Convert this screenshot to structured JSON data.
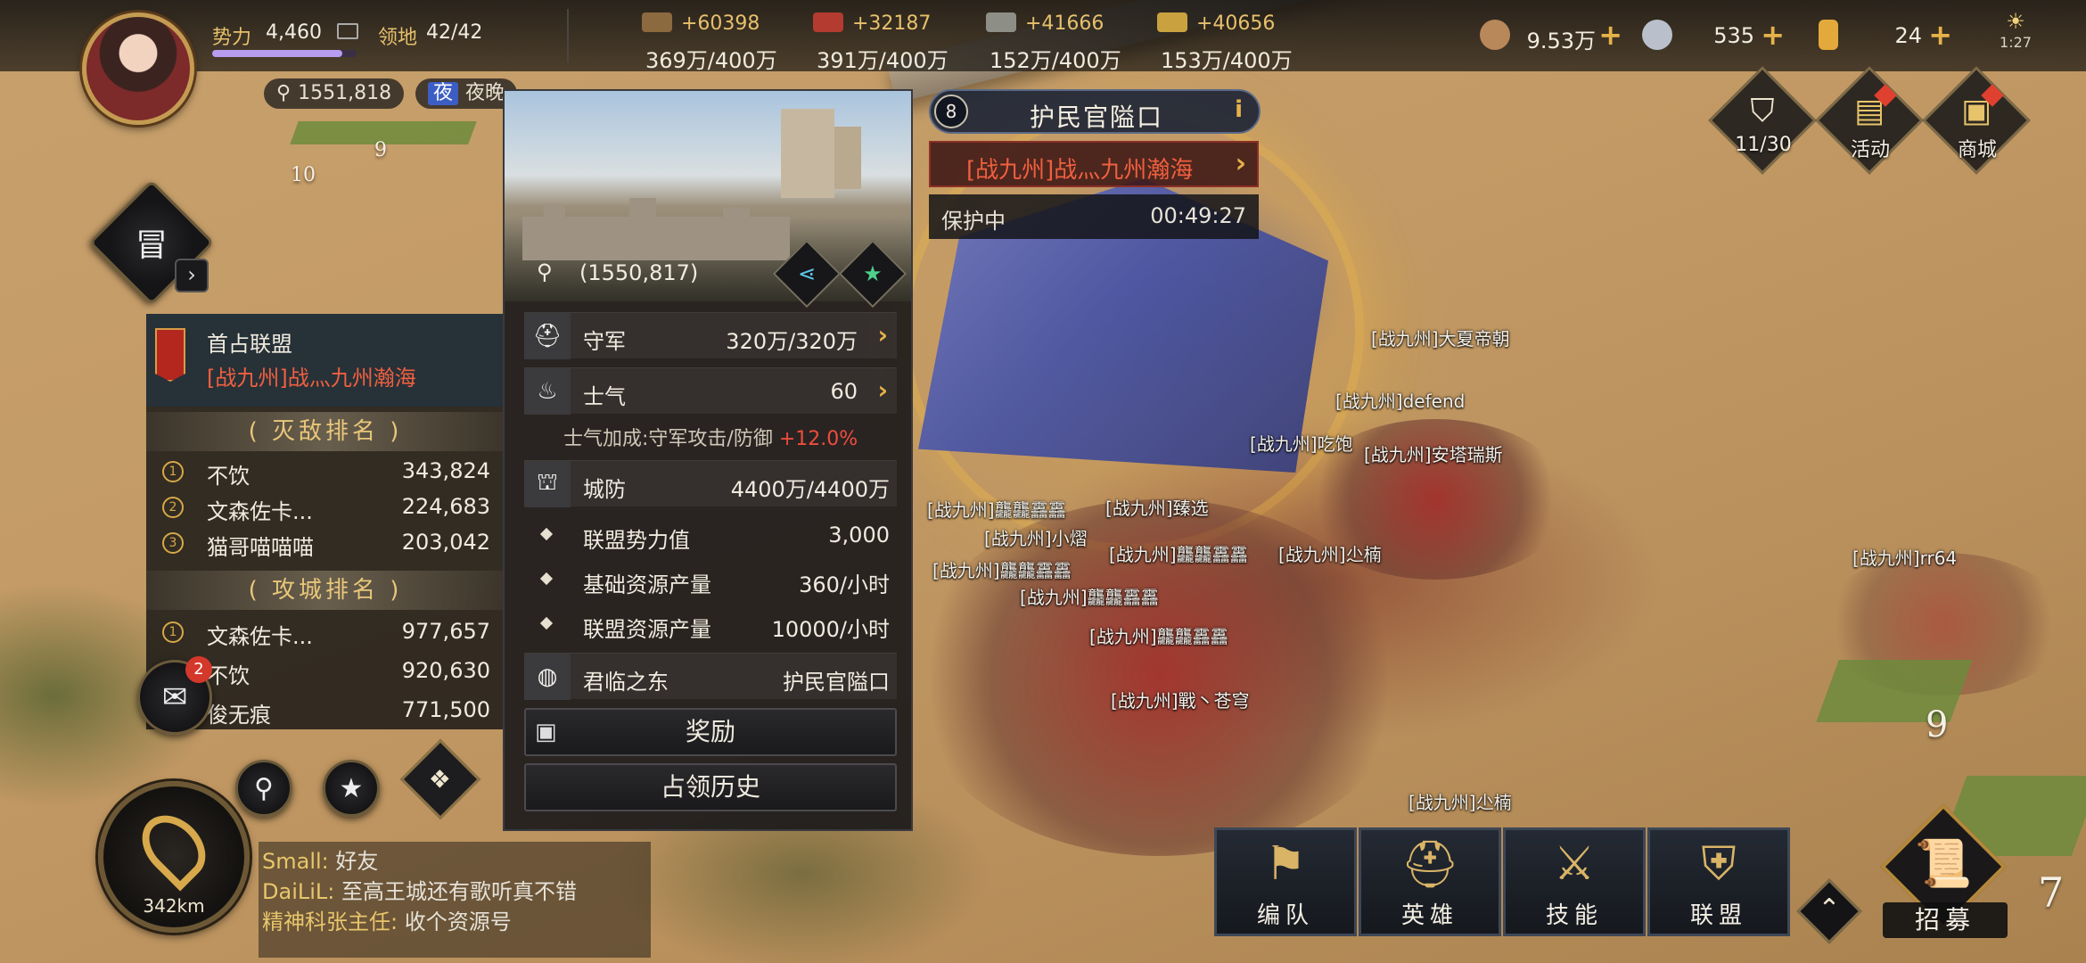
{
  "player": {
    "power_label": "势力",
    "power_value": "4,460",
    "territory_label": "领地",
    "territory_value": "42/42",
    "coord": "1551,818",
    "night_badge": "夜",
    "time_of_day": "夜晚"
  },
  "resources": [
    {
      "delta": "+60398",
      "capacity": "369万/400万",
      "color": "#8a6a3e"
    },
    {
      "delta": "+32187",
      "capacity": "391万/400万",
      "color": "#b43b2f"
    },
    {
      "delta": "+41666",
      "capacity": "152万/400万",
      "color": "#8d8f86"
    },
    {
      "delta": "+40656",
      "capacity": "153万/400万",
      "color": "#c9a23f"
    }
  ],
  "currencies": [
    {
      "value": "9.53万",
      "icon": "copper-coin-icon",
      "color": "#b8875a"
    },
    {
      "value": "535",
      "icon": "silver-coin-icon",
      "color": "#b9c0cc"
    },
    {
      "value": "24",
      "icon": "gold-bar-icon",
      "color": "#e3a93a"
    }
  ],
  "clock": "1:27",
  "city": {
    "level": "8",
    "name": "护民官隘口",
    "owner": "[战九州]战灬九州瀚海",
    "status_label": "保护中",
    "status_time": "00:49:27",
    "coord": "(1550,817)",
    "stats": {
      "garrison_label": "守军",
      "garrison_value": "320万/320万",
      "morale_label": "士气",
      "morale_value": "60",
      "morale_bonus_text": "士气加成:守军攻击/防御",
      "morale_bonus_pct": "+12.0%",
      "defense_label": "城防",
      "defense_value": "4400万/4400万",
      "alliance_power_label": "联盟势力值",
      "alliance_power_value": "3,000",
      "base_output_label": "基础资源产量",
      "base_output_value": "360/小时",
      "alliance_output_label": "联盟资源产量",
      "alliance_output_value": "10000/小时",
      "region_label": "君临之东",
      "region_value": "护民官隘口"
    },
    "reward_button": "奖励",
    "history_button": "占领历史"
  },
  "ranking": {
    "first_alliance_label": "首占联盟",
    "first_alliance_name": "[战九州]战灬九州瀚海",
    "kill_title": "灭敌排名",
    "kill": [
      {
        "no": "1",
        "name": "不饮",
        "value": "343,824"
      },
      {
        "no": "2",
        "name": "文森佐卡...",
        "value": "224,683"
      },
      {
        "no": "3",
        "name": "猫哥喵喵喵",
        "value": "203,042"
      }
    ],
    "siege_title": "攻城排名",
    "siege": [
      {
        "no": "1",
        "name": "文森佐卡...",
        "value": "977,657"
      },
      {
        "no": "2",
        "name": "不饮",
        "value": "920,630"
      },
      {
        "no": "3",
        "name": "俊无痕",
        "value": "771,500"
      }
    ]
  },
  "mail_badge": "2",
  "compass_distance": "342km",
  "chat": [
    {
      "name": "Small:",
      "msg": "好友"
    },
    {
      "name": "DaiLiL:",
      "msg": "至高王城还有歌听真不错"
    },
    {
      "name": "精神科张主任:",
      "msg": "收个资源号"
    }
  ],
  "right_menu": {
    "troops_count": "11/30",
    "activity_label": "活动",
    "shop_label": "商城"
  },
  "bottom_menu": {
    "formation": "编队",
    "heroes": "英雄",
    "skills": "技能",
    "alliance": "联盟",
    "recruit": "招募"
  },
  "map_labels": [
    "[战九州]大夏帝朝",
    "[战九州]defend",
    "[战九州]吃饱",
    "[战九州]安塔瑞斯",
    "[战九州]龘龘靐靐",
    "[战九州]臻选",
    "[战九州]小熠",
    "[战九州]龘龘靐靐",
    "[战九州]尐楠",
    "[战九州]龘龘靐靐",
    "[战九州]龘龘靐靐",
    "[战九州]龘龘靐靐",
    "[战九州]戰丶苍穹",
    "[战九州]尐楠",
    "[战九州]rr64"
  ],
  "map_numbers": [
    "9",
    "7",
    "10",
    "9"
  ]
}
